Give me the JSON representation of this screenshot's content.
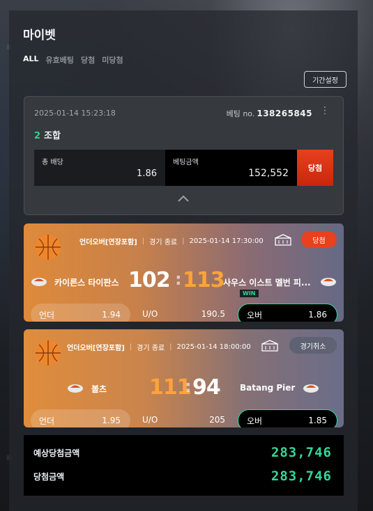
{
  "page": {
    "title": "마이벳"
  },
  "filters": [
    {
      "label": "ALL",
      "active": true
    },
    {
      "label": "유효베팅",
      "active": false
    },
    {
      "label": "당첨",
      "active": false
    },
    {
      "label": "미당첨",
      "active": false
    }
  ],
  "period_button": "기간설정",
  "bet": {
    "datetime": "2025-01-14 15:23:18",
    "bet_no_label": "베팅 no.",
    "bet_no": "138265845",
    "combo_count": "2",
    "combo_label": "조합",
    "odds_label": "총 배당",
    "odds_value": "1.86",
    "amount_label": "베팅금액",
    "amount_value": "152,552",
    "result": "당첨"
  },
  "games": [
    {
      "market": "언더오버[연장포함]",
      "state": "경기 종료",
      "datetime": "2025-01-14 17:30:00",
      "status": "당첨",
      "home_team": "카이른스 타이판스",
      "home_score": "102",
      "away_score": "113",
      "away_team": "사우스 이스트 멜번 피...",
      "under_label": "언더",
      "under_odds": "1.94",
      "uo_label": "U/O",
      "line": "190.5",
      "over_label": "오버",
      "over_odds": "1.86",
      "win_badge": "WIN"
    },
    {
      "market": "언더오버[연장포함]",
      "state": "경기 종료",
      "datetime": "2025-01-14 18:00:00",
      "status": "경기취소",
      "home_team": "볼츠",
      "home_score": "111",
      "away_score": "94",
      "away_team": "Batang Pier",
      "under_label": "언더",
      "under_odds": "1.95",
      "uo_label": "U/O",
      "line": "205",
      "over_label": "오버",
      "over_odds": "1.85"
    }
  ],
  "totals": {
    "expected_label": "예상당첨금액",
    "expected_value": "283,746",
    "won_label": "당첨금액",
    "won_value": "283,746"
  },
  "colors": {
    "accent_green": "#33d79a",
    "win_red": "#e9401e",
    "score_orange": "#ffa33a"
  }
}
